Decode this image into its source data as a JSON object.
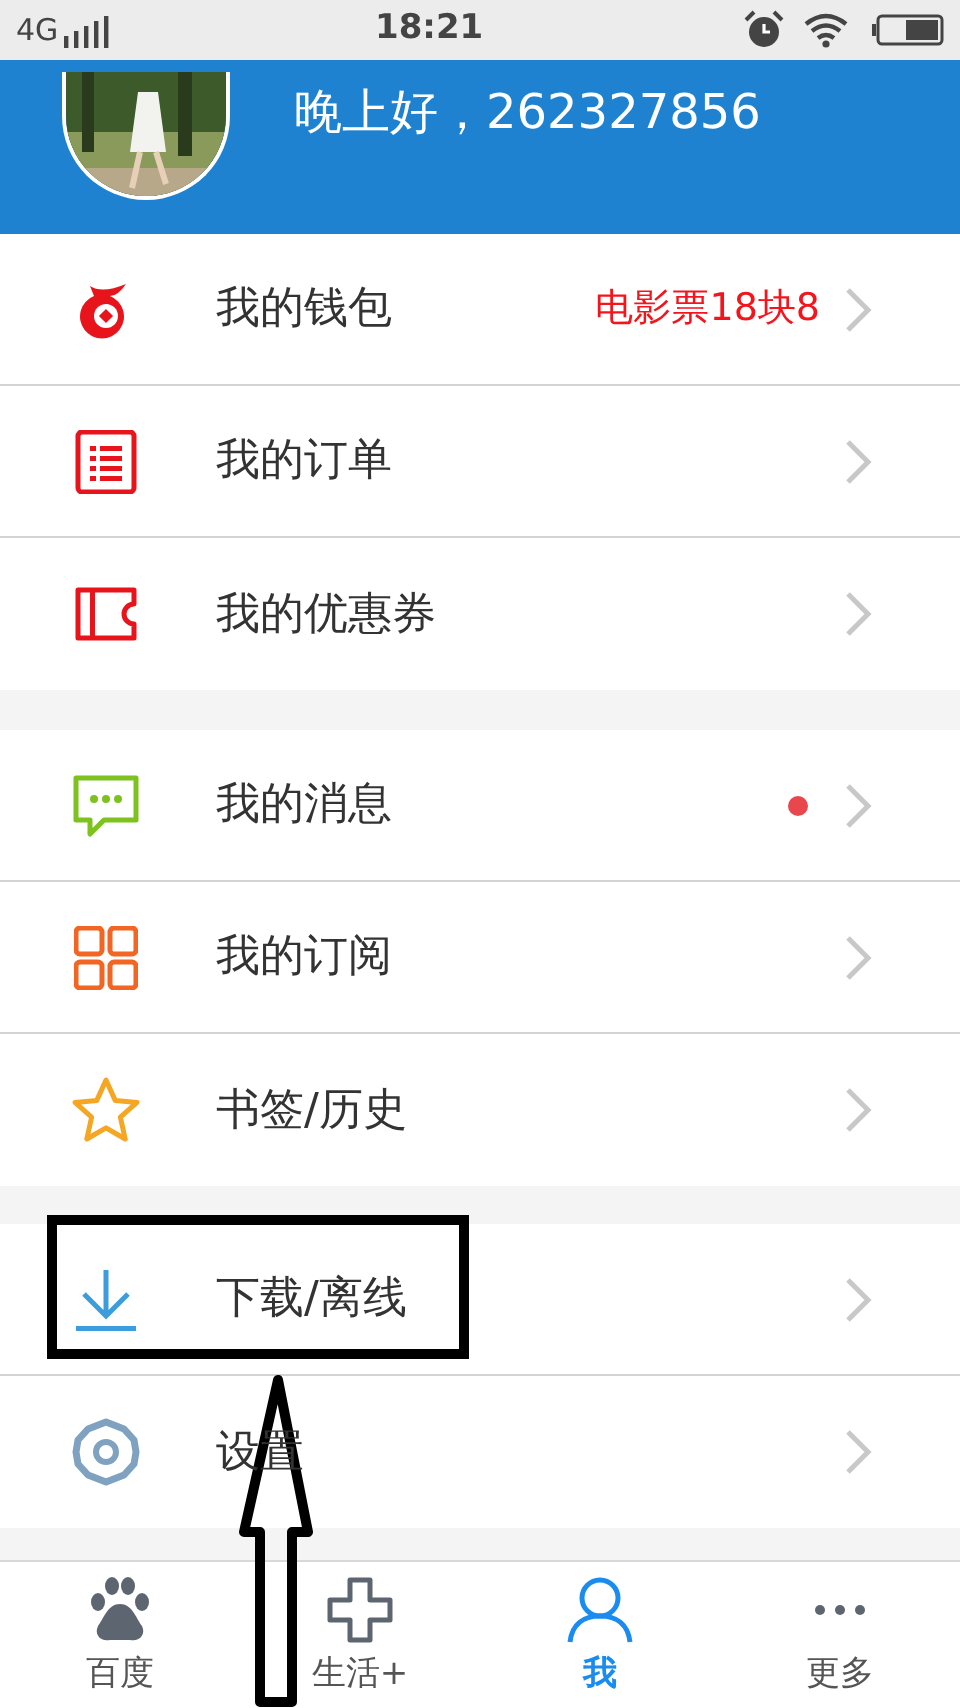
{
  "status_bar": {
    "network": "4G",
    "time": "18:21"
  },
  "header": {
    "greeting": "晚上好，262327856"
  },
  "groups": [
    [
      {
        "label": "我的钱包",
        "note": "电影票18块8",
        "unread": false
      },
      {
        "label": "我的订单",
        "unread": false
      },
      {
        "label": "我的优惠券",
        "unread": false
      }
    ],
    [
      {
        "label": "我的消息",
        "unread": true
      },
      {
        "label": "我的订阅",
        "unread": false
      },
      {
        "label": "书签/历史",
        "unread": false
      }
    ],
    [
      {
        "label": "下载/离线",
        "unread": false
      },
      {
        "label": "设置",
        "unread": false
      }
    ]
  ],
  "tabs": [
    {
      "label": "百度",
      "selected": false
    },
    {
      "label": "生活+",
      "selected": false
    },
    {
      "label": "我",
      "selected": true
    },
    {
      "label": "更多",
      "selected": false
    }
  ]
}
